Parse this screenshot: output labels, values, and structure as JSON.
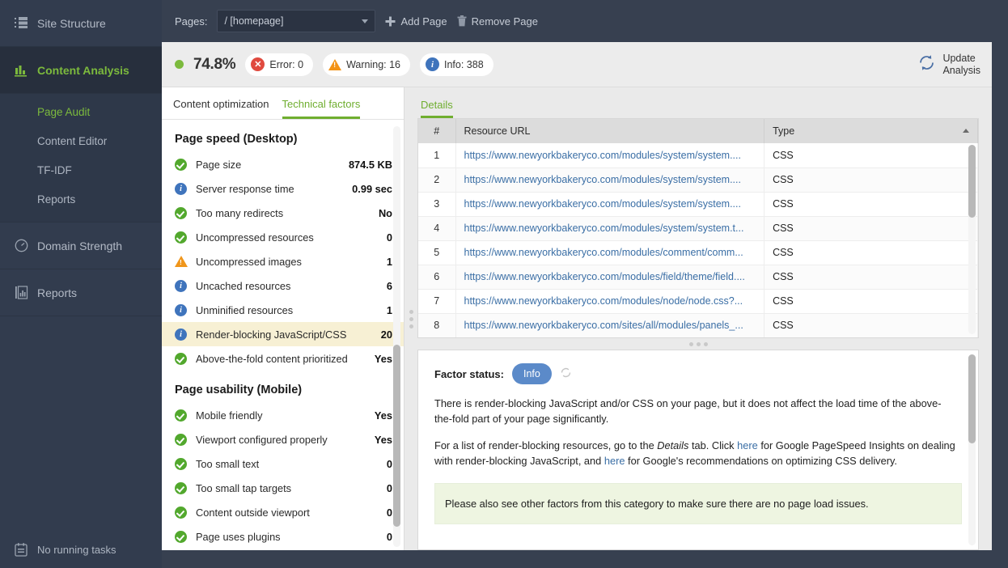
{
  "sidebar": {
    "items": [
      {
        "label": "Site Structure",
        "icon": "list-icon",
        "active": false
      },
      {
        "label": "Content Analysis",
        "icon": "bar-chart-icon",
        "active": true
      },
      {
        "label": "Domain Strength",
        "icon": "gauge-icon",
        "active": false
      },
      {
        "label": "Reports",
        "icon": "report-icon",
        "active": false
      }
    ],
    "sub_items": [
      {
        "label": "Page Audit",
        "active": true
      },
      {
        "label": "Content Editor",
        "active": false
      },
      {
        "label": "TF-IDF",
        "active": false
      },
      {
        "label": "Reports",
        "active": false
      }
    ],
    "tasks_label": "No running tasks",
    "tasks_icon": "tasks-icon"
  },
  "pagebar": {
    "label": "Pages:",
    "selected_page": "/ [homepage]",
    "add_page": "Add Page",
    "remove_page": "Remove Page",
    "add_icon": "plus-icon",
    "remove_icon": "trash-icon",
    "dropdown_icon": "chevron-down-icon"
  },
  "statusbar": {
    "score": "74.8%",
    "score_dot_color": "#7cba3d",
    "error_label": "Error: 0",
    "warning_label": "Warning: 16",
    "info_label": "Info: 388",
    "error_color": "#e04a3f",
    "warning_color": "#f39316",
    "info_color": "#3f74bc",
    "update_line1": "Update",
    "update_line2": "Analysis",
    "update_icon": "refresh-icon"
  },
  "left_panel": {
    "tabs": [
      {
        "label": "Content optimization",
        "active": false
      },
      {
        "label": "Technical factors",
        "active": true
      }
    ],
    "groups": [
      {
        "title": "Page speed (Desktop)",
        "rows": [
          {
            "status": "ok",
            "name": "Page size",
            "value": "874.5 KB",
            "selected": false
          },
          {
            "status": "info",
            "name": "Server response time",
            "value": "0.99 sec",
            "selected": false
          },
          {
            "status": "ok",
            "name": "Too many redirects",
            "value": "No",
            "selected": false
          },
          {
            "status": "ok",
            "name": "Uncompressed resources",
            "value": "0",
            "selected": false
          },
          {
            "status": "warn",
            "name": "Uncompressed images",
            "value": "1",
            "selected": false
          },
          {
            "status": "info",
            "name": "Uncached resources",
            "value": "6",
            "selected": false
          },
          {
            "status": "info",
            "name": "Unminified resources",
            "value": "1",
            "selected": false
          },
          {
            "status": "info",
            "name": "Render-blocking JavaScript/CSS",
            "value": "20",
            "selected": true
          },
          {
            "status": "ok",
            "name": "Above-the-fold content prioritized",
            "value": "Yes",
            "selected": false
          }
        ]
      },
      {
        "title": "Page usability (Mobile)",
        "rows": [
          {
            "status": "ok",
            "name": "Mobile friendly",
            "value": "Yes",
            "selected": false
          },
          {
            "status": "ok",
            "name": "Viewport configured properly",
            "value": "Yes",
            "selected": false
          },
          {
            "status": "ok",
            "name": "Too small text",
            "value": "0",
            "selected": false
          },
          {
            "status": "ok",
            "name": "Too small tap targets",
            "value": "0",
            "selected": false
          },
          {
            "status": "ok",
            "name": "Content outside viewport",
            "value": "0",
            "selected": false
          },
          {
            "status": "ok",
            "name": "Page uses plugins",
            "value": "0",
            "selected": false
          }
        ]
      }
    ]
  },
  "details": {
    "tab_label": "Details",
    "columns": [
      "#",
      "Resource URL",
      "Type"
    ],
    "sort_column": "Type",
    "sort_direction": "asc",
    "rows": [
      {
        "num": "1",
        "url": "https://www.newyorkbakeryco.com/modules/system/system....",
        "type": "CSS"
      },
      {
        "num": "2",
        "url": "https://www.newyorkbakeryco.com/modules/system/system....",
        "type": "CSS"
      },
      {
        "num": "3",
        "url": "https://www.newyorkbakeryco.com/modules/system/system....",
        "type": "CSS"
      },
      {
        "num": "4",
        "url": "https://www.newyorkbakeryco.com/modules/system/system.t...",
        "type": "CSS"
      },
      {
        "num": "5",
        "url": "https://www.newyorkbakeryco.com/modules/comment/comm...",
        "type": "CSS"
      },
      {
        "num": "6",
        "url": "https://www.newyorkbakeryco.com/modules/field/theme/field....",
        "type": "CSS"
      },
      {
        "num": "7",
        "url": "https://www.newyorkbakeryco.com/modules/node/node.css?...",
        "type": "CSS"
      },
      {
        "num": "8",
        "url": "https://www.newyorkbakeryco.com/sites/all/modules/panels_...",
        "type": "CSS"
      }
    ]
  },
  "factor_status": {
    "label": "Factor status:",
    "status": "Info",
    "status_color": "#5b8ac9",
    "refresh_icon": "refresh-small-icon",
    "paragraph1": "There is render-blocking JavaScript and/or CSS on your page, but it does not affect the load time of the above-the-fold part of your page significantly.",
    "paragraph2_a": "For a list of render-blocking resources, go to the ",
    "paragraph2_em": "Details",
    "paragraph2_b": " tab. Click ",
    "paragraph2_link1": "here",
    "paragraph2_c": " for Google PageSpeed Insights on dealing with render-blocking JavaScript, and ",
    "paragraph2_link2": "here",
    "paragraph2_d": " for Google's recommendations on optimizing CSS delivery.",
    "note": "Please also see other factors from this category to make sure there are no page load issues."
  }
}
